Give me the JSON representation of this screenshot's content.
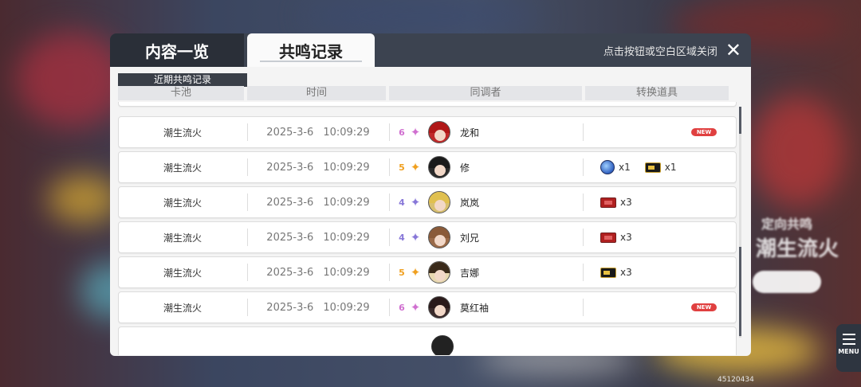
{
  "tabs": [
    {
      "label": "内容一览",
      "active": false
    },
    {
      "label": "共鸣记录",
      "active": true
    }
  ],
  "close_hint": "点击按钮或空白区域关闭",
  "section_label": "近期共鸣记录",
  "columns": [
    "卡池",
    "时间",
    "同调者",
    "转换道具"
  ],
  "rows": [
    {
      "pool": "潮生流火",
      "date": "2025-3-6",
      "time": "10:09:29",
      "rarity": "6",
      "name": "龙和",
      "items": [],
      "new": true
    },
    {
      "pool": "潮生流火",
      "date": "2025-3-6",
      "time": "10:09:29",
      "rarity": "5",
      "name": "修",
      "items": [
        {
          "icon": "gear-token-icon",
          "qty": "x1"
        },
        {
          "icon": "gold-ticket-icon",
          "qty": "x1"
        }
      ],
      "new": false
    },
    {
      "pool": "潮生流火",
      "date": "2025-3-6",
      "time": "10:09:29",
      "rarity": "4",
      "name": "岚岚",
      "items": [
        {
          "icon": "red-ticket-icon",
          "qty": "x3"
        }
      ],
      "new": false
    },
    {
      "pool": "潮生流火",
      "date": "2025-3-6",
      "time": "10:09:29",
      "rarity": "4",
      "name": "刘兄",
      "items": [
        {
          "icon": "red-ticket-icon",
          "qty": "x3"
        }
      ],
      "new": false
    },
    {
      "pool": "潮生流火",
      "date": "2025-3-6",
      "time": "10:09:29",
      "rarity": "5",
      "name": "吉娜",
      "items": [
        {
          "icon": "gold-ticket-icon",
          "qty": "x3"
        }
      ],
      "new": false
    },
    {
      "pool": "潮生流火",
      "date": "2025-3-6",
      "time": "10:09:29",
      "rarity": "6",
      "name": "莫红袖",
      "items": [],
      "new": true
    }
  ],
  "new_label": "NEW",
  "star_glyph": "✦",
  "menu_label": "MENU",
  "uid": "45120434",
  "background": {
    "banner_title": "潮生流火",
    "banner_sub": "定向共鸣"
  }
}
